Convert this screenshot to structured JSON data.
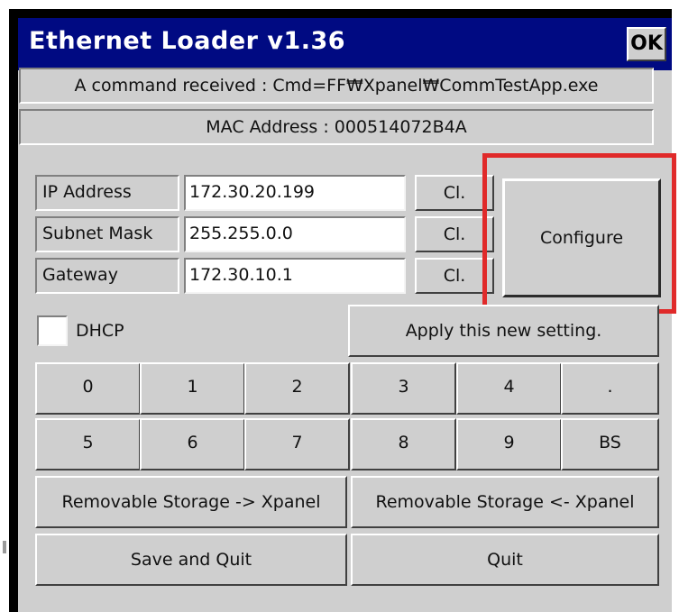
{
  "window": {
    "title": "Ethernet Loader v1.36",
    "ok_label": "OK"
  },
  "status_message": "A command received : Cmd=FF₩Xpanel₩CommTestApp.exe",
  "mac_address_text": "MAC Address : 000514072B4A",
  "network": {
    "ip": {
      "label": "IP Address",
      "value": "172.30.20.199",
      "clear_label": "Cl."
    },
    "subnet": {
      "label": "Subnet Mask",
      "value": "255.255.0.0",
      "clear_label": "Cl."
    },
    "gateway": {
      "label": "Gateway",
      "value": "172.30.10.1",
      "clear_label": "Cl."
    }
  },
  "configure_label": "Configure",
  "dhcp": {
    "label": "DHCP",
    "checked": false
  },
  "apply_label": "Apply this new setting.",
  "keypad": {
    "row1": [
      "0",
      "1",
      "2",
      "3",
      "4",
      "."
    ],
    "row2": [
      "5",
      "6",
      "7",
      "8",
      "9",
      "BS"
    ]
  },
  "storage": {
    "to_xpanel": "Removable Storage -> Xpanel",
    "from_xpanel": "Removable Storage <- Xpanel"
  },
  "footer": {
    "save_quit": "Save and Quit",
    "quit": "Quit"
  },
  "colors": {
    "titlebar": "#000a82",
    "face": "#cfcfcf",
    "highlight": "#e02a2a"
  }
}
